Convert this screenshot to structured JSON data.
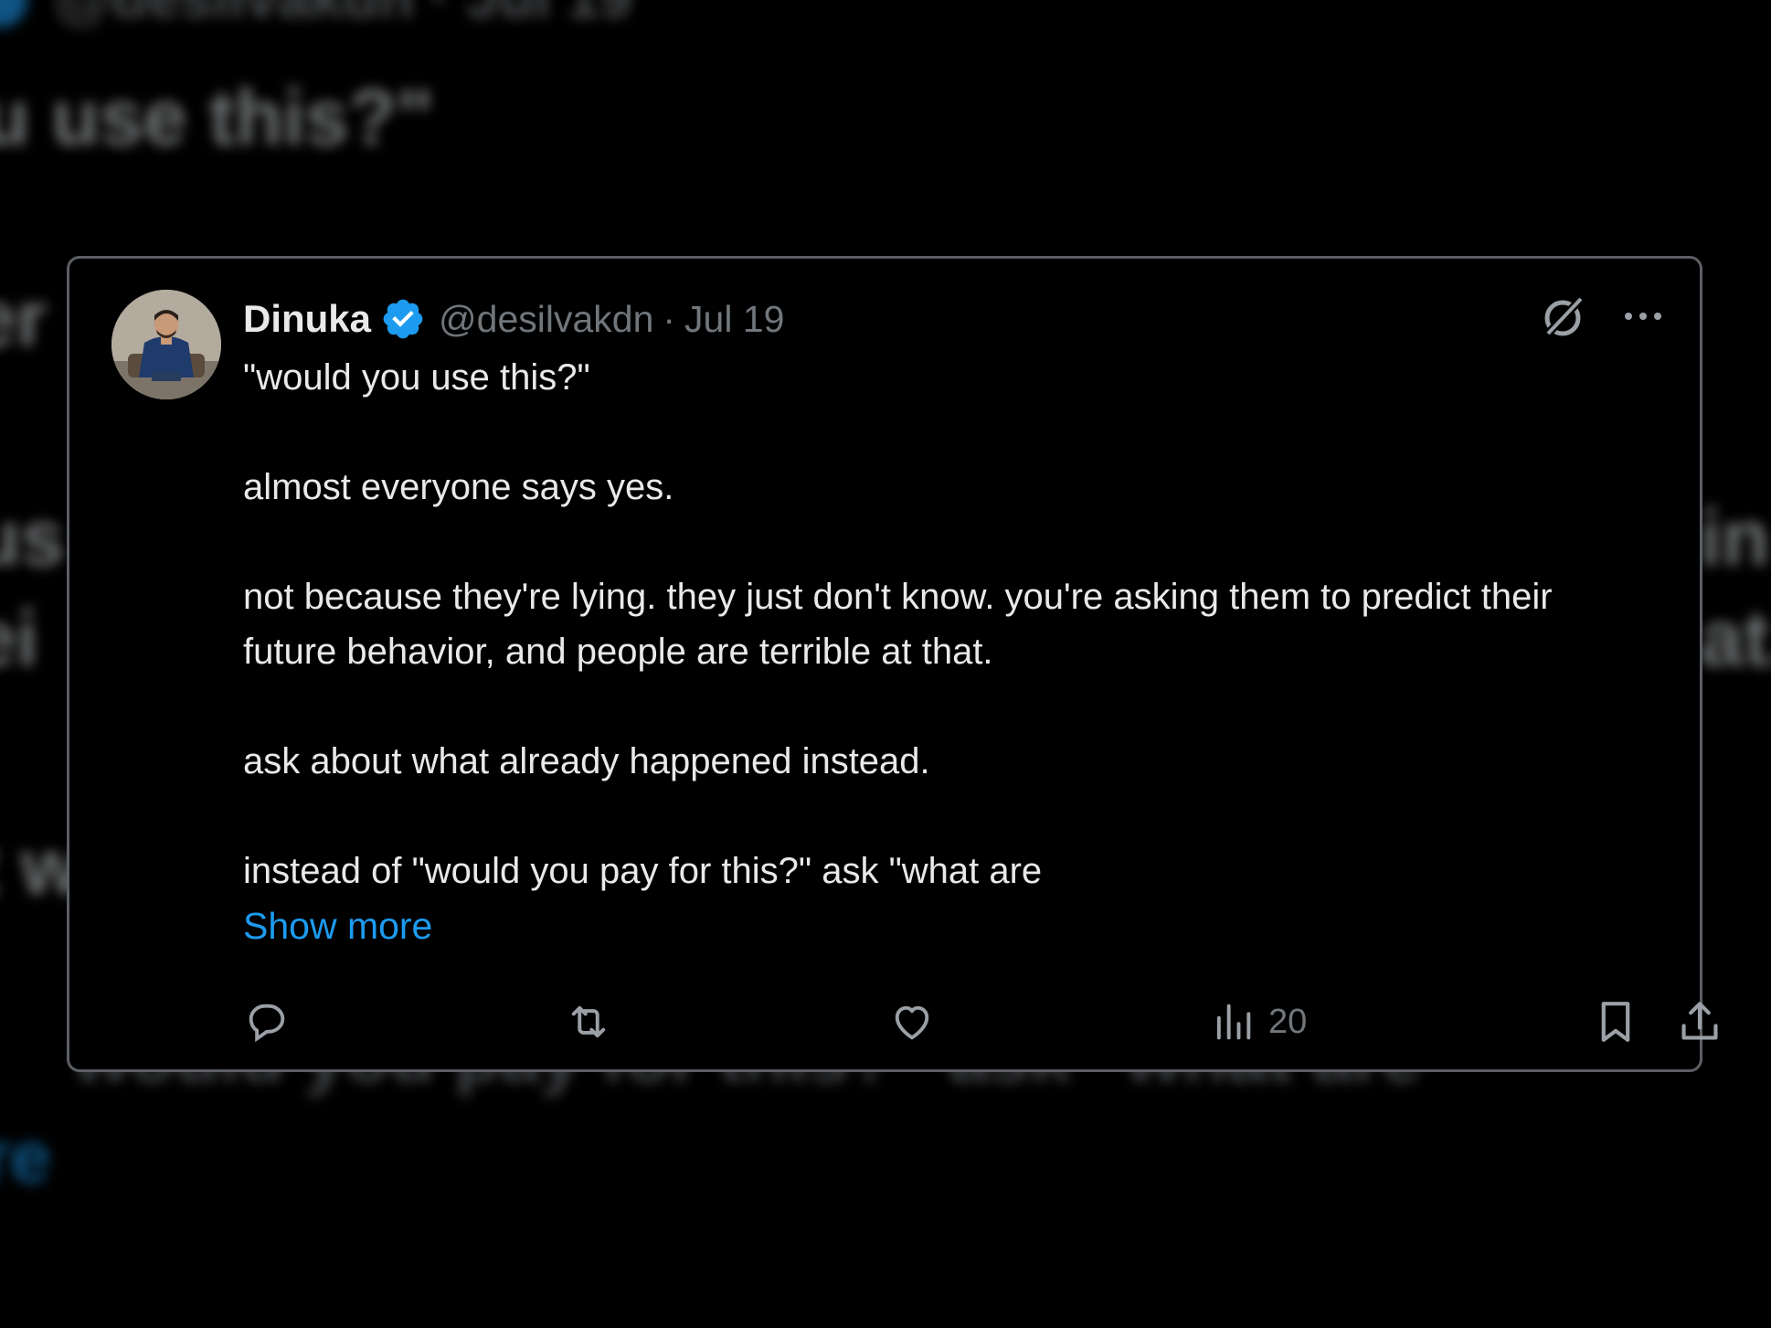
{
  "background": {
    "handle_echo": "@desilvakdn · Jul 19",
    "line1": "u use this?\"",
    "line2": "er",
    "line3": "us",
    "line4": "ei",
    "line5": "t w",
    "line6": "would you pay for this?\" ask \"what are",
    "line7": "re",
    "right1": "in",
    "right2": "at."
  },
  "tweet": {
    "author_name": "Dinuka",
    "handle": "@desilvakdn",
    "separator": "·",
    "date": "Jul 19",
    "paragraphs": [
      "\"would you use this?\"",
      "almost everyone says yes.",
      "not because they're lying. they just don't know. you're asking them to predict their future behavior, and people are terrible at that.",
      "ask about what already happened instead.",
      "instead of \"would you pay for this?\" ask \"what are"
    ],
    "show_more": "Show more"
  },
  "actions": {
    "views_count": "20"
  },
  "colors": {
    "accent": "#1d9bf0",
    "text_primary": "#e7e9ea",
    "text_secondary": "#71767b",
    "card_border": "#5b5f63",
    "background": "#000000"
  },
  "icons": {
    "verified": "verified-badge-icon",
    "grok": "grok-icon",
    "more": "more-dots-icon",
    "reply": "reply-icon",
    "repost": "repost-icon",
    "like": "heart-icon",
    "views": "views-chart-icon",
    "bookmark": "bookmark-icon",
    "share": "share-icon"
  }
}
